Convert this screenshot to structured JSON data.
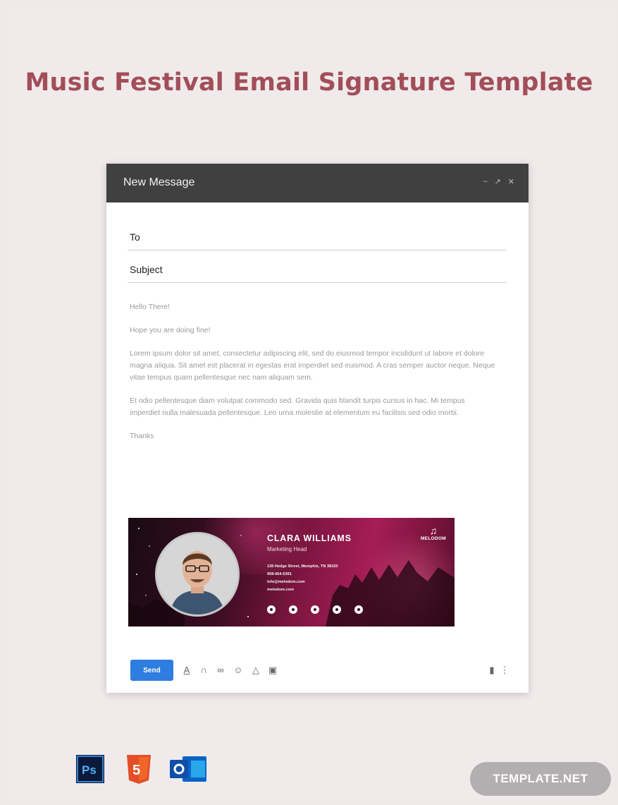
{
  "page": {
    "title": "Music Festival  Email Signature Template"
  },
  "compose": {
    "header_title": "New Message",
    "to_label": "To",
    "subject_label": "Subject",
    "greeting": "Hello There!",
    "line1": "Hope you are doing fine!",
    "para1": "Lorem ipsum dolor sit amet, consectetur adipiscing elit, sed do eiusmod tempor incididunt ut labore et dolore magna aliqua. Sit amet est placerat in egestas erat imperdiet sed euismod. A cras semper auctor neque. Neque vitae tempus quam pellentesque nec nam aliquam sem.",
    "para2": " Et odio pellentesque diam volutpat commodo sed. Gravida quis blandit turpis cursus in hac. Mi tempus imperdiet nulla malesuada pellentesque. Leo urna molestie at elementum eu facilisis sed odio morbi.",
    "closing": "Thanks",
    "send_label": "Send"
  },
  "signature": {
    "name": "CLARA WILLIAMS",
    "role": "Marketing Head",
    "address": "136 Hedge Street, Memphis, TN 38103",
    "phone": "908-664-5391",
    "email": "info@melodom.com",
    "website": "melodom.com",
    "logo_text": "MELODOM",
    "socials": [
      "facebook-icon",
      "twitter-icon",
      "youtube-icon",
      "instagram-icon",
      "pinterest-icon"
    ]
  },
  "footer": {
    "badge": "TEMPLATE.NET",
    "apps": [
      "photoshop-icon",
      "html5-icon",
      "outlook-icon"
    ]
  },
  "colors": {
    "title": "#a24e58",
    "header": "#404040",
    "send": "#2f7de1",
    "signature_accent": "#a61d55"
  }
}
